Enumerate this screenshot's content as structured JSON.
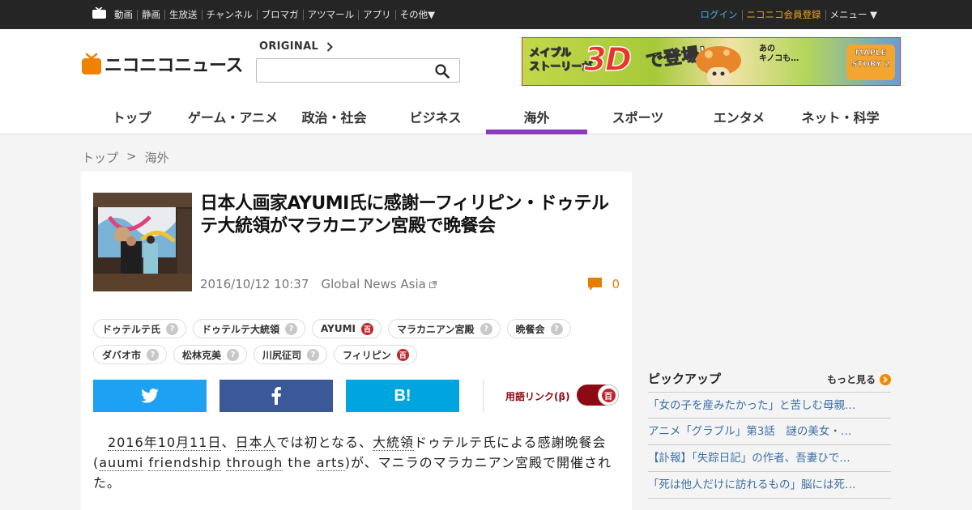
{
  "global_nav": {
    "left_items": [
      "動画",
      "静画",
      "生放送",
      "チャンネル",
      "ブロマガ",
      "アツマール",
      "アプリ",
      "その他▼"
    ],
    "right_items": [
      {
        "label": "ログイン",
        "color": "#4aa9e2"
      },
      {
        "label": "ニコニコ会員登録",
        "color": "#e9a21b"
      },
      {
        "label": "メニュー ▼",
        "color": "#e8e8e8"
      }
    ]
  },
  "header": {
    "logo_text": "ニコニコニュース",
    "original_label": "ORIGINAL",
    "search": {
      "placeholder": "",
      "value": ""
    },
    "banner": {
      "line1": "メイプル",
      "line2": "ストーリーが",
      "big": "3D",
      "sub": "で登場!",
      "mushroom_text_1": "あの",
      "mushroom_text_2": "キノコも…",
      "badge": "MAPLE STORY 2"
    }
  },
  "category_nav": {
    "items": [
      "トップ",
      "ゲーム・アニメ",
      "政治・社会",
      "ビジネス",
      "海外",
      "スポーツ",
      "エンタメ",
      "ネット・科学"
    ],
    "active": "海外",
    "active_color": "#8c3bbd"
  },
  "breadcrumb": {
    "home": "トップ",
    "separator": ">",
    "current": "海外"
  },
  "article": {
    "title": "日本人画家AYUMI氏に感謝ーフィリピン・ドゥテルテ大統領がマラカニアン宮殿で晩餐会",
    "date": "2016/10/12 10:37",
    "source": "Global News Asia",
    "comment_count": "0",
    "tags": [
      [
        {
          "label": "ドゥテルテ氏",
          "badge": "?",
          "kind": "q"
        },
        {
          "label": "ドゥテルテ大統領",
          "badge": "?",
          "kind": "q"
        },
        {
          "label": "AYUMI",
          "badge": "百",
          "kind": "d"
        },
        {
          "label": "マラカニアン宮殿",
          "badge": "?",
          "kind": "q"
        },
        {
          "label": "晩餐会",
          "badge": "?",
          "kind": "q"
        }
      ],
      [
        {
          "label": "ダバオ市",
          "badge": "?",
          "kind": "q"
        },
        {
          "label": "松林克美",
          "badge": "?",
          "kind": "q"
        },
        {
          "label": "川尻征司",
          "badge": "?",
          "kind": "q"
        },
        {
          "label": "フィリピン",
          "badge": "百",
          "kind": "d"
        }
      ]
    ],
    "share": {
      "hatena_label": "B!"
    },
    "glossary_label": "用語リンク(β)",
    "glossary_toggle_icon": "百",
    "glossary_enabled": true,
    "body": {
      "s1": "2016年10月11日",
      "s2": "、",
      "s3": "日本人",
      "s4": "では初となる、",
      "s5": "大統領",
      "s6": "ドゥテルテ氏による感謝晩餐会(",
      "s7": "auumi",
      "s8": " ",
      "s9": "friendship",
      "s10": " ",
      "s11": "through",
      "s12": " the ",
      "s13": "arts",
      "s14": ")が、マニラのマラカニアン宮殿で開催された。"
    }
  },
  "sidebar": {
    "pickup_title": "ピックアップ",
    "more_label": "もっと見る",
    "items": [
      "「女の子を産みたかった」と苦しむ母親…",
      "アニメ「グラブル」第3話　謎の美女・…",
      "【訃報】「失踪日記」の作者、吾妻ひで…",
      "「死は他人だけに訪れるもの」脳には死…"
    ]
  }
}
